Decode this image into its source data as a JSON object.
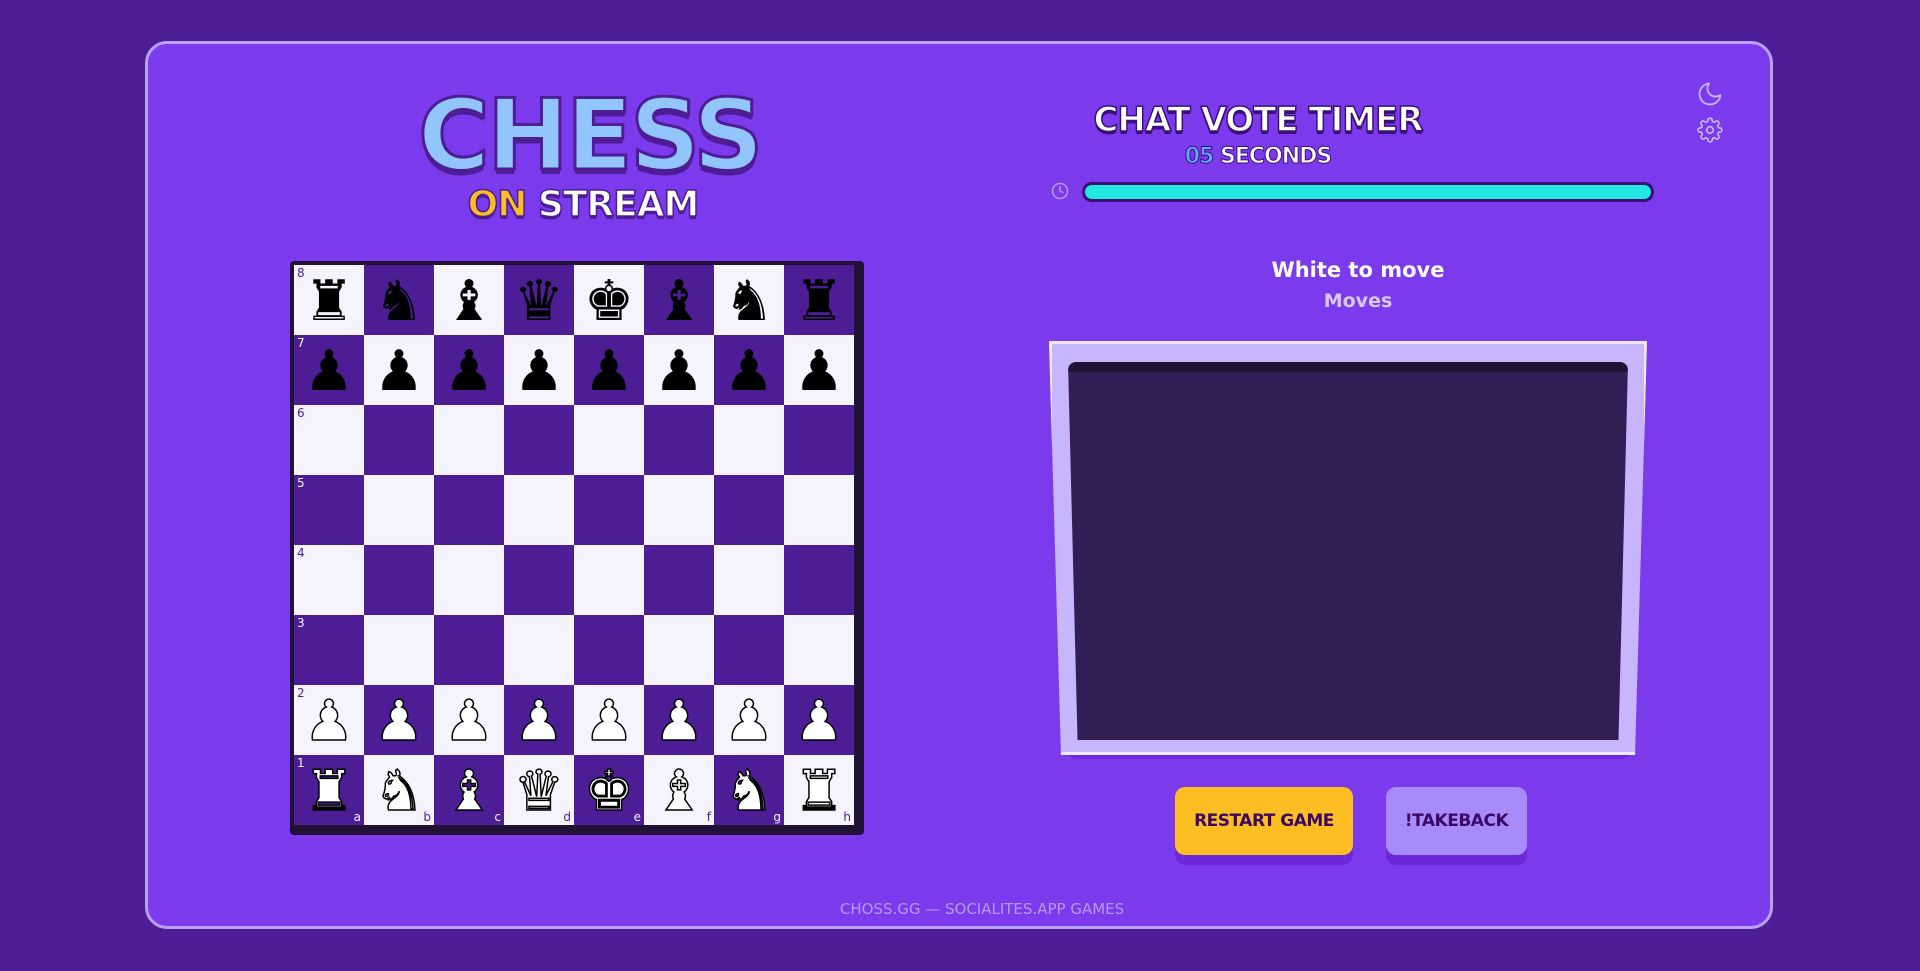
{
  "logo": {
    "title": "CHESS",
    "on": "ON",
    "stream": "STREAM"
  },
  "timer": {
    "title": "CHAT VOTE TIMER",
    "seconds_value": "05",
    "seconds_label": "SECONDS",
    "progress": 1.0,
    "icon": "clock-icon"
  },
  "top_icons": [
    "moon-icon",
    "gear-icon"
  ],
  "status": {
    "turn": "White to move",
    "moves_label": "Moves"
  },
  "moves": [],
  "buttons": {
    "restart": "RESTART GAME",
    "takeback": "!TAKEBACK"
  },
  "footer": "CHOSS.GG — SOCIALITES.APP GAMES",
  "board": {
    "files": [
      "a",
      "b",
      "c",
      "d",
      "e",
      "f",
      "g",
      "h"
    ],
    "ranks": [
      "8",
      "7",
      "6",
      "5",
      "4",
      "3",
      "2",
      "1"
    ],
    "position": [
      [
        "r",
        "n",
        "b",
        "q",
        "k",
        "b",
        "n",
        "r"
      ],
      [
        "p",
        "p",
        "p",
        "p",
        "p",
        "p",
        "p",
        "p"
      ],
      [
        "",
        "",
        "",
        "",
        "",
        "",
        "",
        ""
      ],
      [
        "",
        "",
        "",
        "",
        "",
        "",
        "",
        ""
      ],
      [
        "",
        "",
        "",
        "",
        "",
        "",
        "",
        ""
      ],
      [
        "",
        "",
        "",
        "",
        "",
        "",
        "",
        ""
      ],
      [
        "P",
        "P",
        "P",
        "P",
        "P",
        "P",
        "P",
        "P"
      ],
      [
        "R",
        "N",
        "B",
        "Q",
        "K",
        "B",
        "N",
        "R"
      ]
    ]
  },
  "colors": {
    "background": "#4c1d95",
    "panel": "#7c3aed",
    "light_square": "#f5f3fb",
    "dark_square": "#4c1d95",
    "accent_yellow": "#fbbf24",
    "accent_cyan": "#22e8e0",
    "accent_blue": "#93c5fd"
  }
}
